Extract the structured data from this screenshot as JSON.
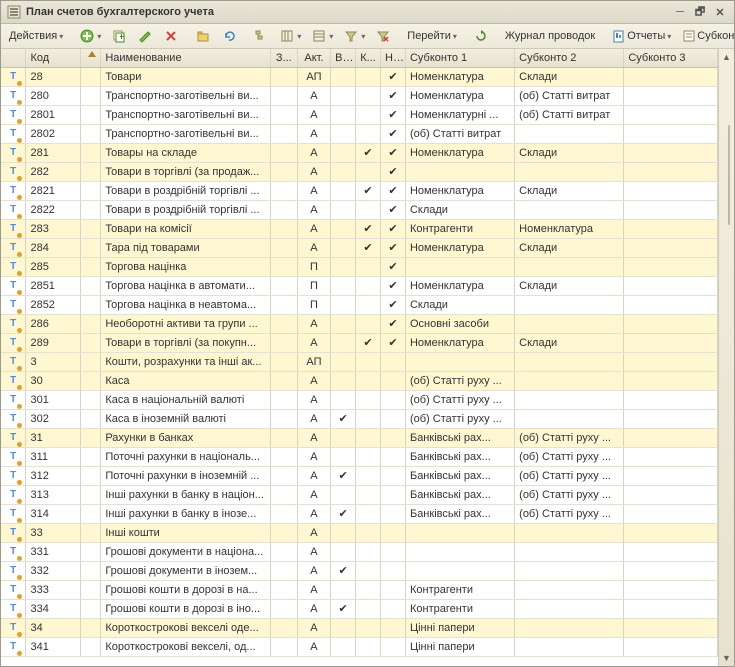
{
  "window": {
    "title": "План счетов бухгалтерского учета"
  },
  "toolbar": {
    "actions": "Действия",
    "go": "Перейти",
    "journal": "Журнал проводок",
    "reports": "Отчеты",
    "subkonto": "Субконто"
  },
  "columns": {
    "icon": "",
    "kod": "Код",
    "sort": "",
    "name": "Наименование",
    "z": "З...",
    "akt": "Акт.",
    "v": "В...",
    "k": "К...",
    "n": "Н...",
    "s1": "Субконто 1",
    "s2": "Субконто 2",
    "s3": "Субконто 3"
  },
  "rows": [
    {
      "kod": "28",
      "name": "Товари",
      "akt": "АП",
      "v": "",
      "k": "",
      "n": "✔",
      "s1": "Номенклатура",
      "s2": "Склади",
      "s3": "",
      "hl": true
    },
    {
      "kod": "280",
      "name": "Транспортно-заготівельні ви...",
      "akt": "А",
      "v": "",
      "k": "",
      "n": "✔",
      "s1": "Номенклатура",
      "s2": "(об) Статті витрат",
      "s3": ""
    },
    {
      "kod": "2801",
      "name": "Транспортно-заготівельні ви...",
      "akt": "А",
      "v": "",
      "k": "",
      "n": "✔",
      "s1": "Номенклатурні ...",
      "s2": "(об) Статті витрат",
      "s3": ""
    },
    {
      "kod": "2802",
      "name": "Транспортно-заготівельні ви...",
      "akt": "А",
      "v": "",
      "k": "",
      "n": "✔",
      "s1": "(об) Статті витрат",
      "s2": "",
      "s3": ""
    },
    {
      "kod": "281",
      "name": "Товары на складе",
      "akt": "А",
      "v": "",
      "k": "✔",
      "n": "✔",
      "s1": "Номенклатура",
      "s2": "Склади",
      "s3": "",
      "hl": true
    },
    {
      "kod": "282",
      "name": "Товари в торгівлі (за продаж...",
      "akt": "А",
      "v": "",
      "k": "",
      "n": "✔",
      "s1": "",
      "s2": "",
      "s3": "",
      "hl": true
    },
    {
      "kod": "2821",
      "name": "Товари в роздрібній торгівлі ...",
      "akt": "А",
      "v": "",
      "k": "✔",
      "n": "✔",
      "s1": "Номенклатура",
      "s2": "Склади",
      "s3": ""
    },
    {
      "kod": "2822",
      "name": "Товари в роздрібній торгівлі ...",
      "akt": "А",
      "v": "",
      "k": "",
      "n": "✔",
      "s1": "Склади",
      "s2": "",
      "s3": ""
    },
    {
      "kod": "283",
      "name": "Товари на комісії",
      "akt": "А",
      "v": "",
      "k": "✔",
      "n": "✔",
      "s1": "Контрагенти",
      "s2": "Номенклатура",
      "s3": "",
      "hl": true
    },
    {
      "kod": "284",
      "name": "Тара під товарами",
      "akt": "А",
      "v": "",
      "k": "✔",
      "n": "✔",
      "s1": "Номенклатура",
      "s2": "Склади",
      "s3": "",
      "hl": true
    },
    {
      "kod": "285",
      "name": "Торгова націнка",
      "akt": "П",
      "v": "",
      "k": "",
      "n": "✔",
      "s1": "",
      "s2": "",
      "s3": "",
      "hl": true
    },
    {
      "kod": "2851",
      "name": "Торгова націнка в автомати...",
      "akt": "П",
      "v": "",
      "k": "",
      "n": "✔",
      "s1": "Номенклатура",
      "s2": "Склади",
      "s3": ""
    },
    {
      "kod": "2852",
      "name": "Торгова націнка в неавтома...",
      "akt": "П",
      "v": "",
      "k": "",
      "n": "✔",
      "s1": "Склади",
      "s2": "",
      "s3": ""
    },
    {
      "kod": "286",
      "name": "Необоротні активи та групи ...",
      "akt": "А",
      "v": "",
      "k": "",
      "n": "✔",
      "s1": "Основні засоби",
      "s2": "",
      "s3": "",
      "hl": true
    },
    {
      "kod": "289",
      "name": "Товари в торгівлі (за покупн...",
      "akt": "А",
      "v": "",
      "k": "✔",
      "n": "✔",
      "s1": "Номенклатура",
      "s2": "Склади",
      "s3": "",
      "hl": true
    },
    {
      "kod": "3",
      "name": "Кошти, розрахунки та інші ак...",
      "akt": "АП",
      "v": "",
      "k": "",
      "n": "",
      "s1": "",
      "s2": "",
      "s3": "",
      "hl": true
    },
    {
      "kod": "30",
      "name": "Каса",
      "akt": "А",
      "v": "",
      "k": "",
      "n": "",
      "s1": "(об) Статті руху ...",
      "s2": "",
      "s3": "",
      "hl": true
    },
    {
      "kod": "301",
      "name": "Каса в національній валюті",
      "akt": "А",
      "v": "",
      "k": "",
      "n": "",
      "s1": "(об) Статті руху ...",
      "s2": "",
      "s3": ""
    },
    {
      "kod": "302",
      "name": "Каса в іноземній валюті",
      "akt": "А",
      "v": "✔",
      "k": "",
      "n": "",
      "s1": "(об) Статті руху ...",
      "s2": "",
      "s3": ""
    },
    {
      "kod": "31",
      "name": "Рахунки в банках",
      "akt": "А",
      "v": "",
      "k": "",
      "n": "",
      "s1": "Банківські рах...",
      "s2": "(об) Статті руху ...",
      "s3": "",
      "hl": true
    },
    {
      "kod": "311",
      "name": "Поточні рахунки в національ...",
      "akt": "А",
      "v": "",
      "k": "",
      "n": "",
      "s1": "Банківські рах...",
      "s2": "(об) Статті руху ...",
      "s3": ""
    },
    {
      "kod": "312",
      "name": "Поточні рахунки в іноземній ...",
      "akt": "А",
      "v": "✔",
      "k": "",
      "n": "",
      "s1": "Банківські рах...",
      "s2": "(об) Статті руху ...",
      "s3": ""
    },
    {
      "kod": "313",
      "name": "Інші рахунки в банку в націон...",
      "akt": "А",
      "v": "",
      "k": "",
      "n": "",
      "s1": "Банківські рах...",
      "s2": "(об) Статті руху ...",
      "s3": ""
    },
    {
      "kod": "314",
      "name": "Інші рахунки в банку в інозе...",
      "akt": "А",
      "v": "✔",
      "k": "",
      "n": "",
      "s1": "Банківські рах...",
      "s2": "(об) Статті руху ...",
      "s3": ""
    },
    {
      "kod": "33",
      "name": "Інші кошти",
      "akt": "А",
      "v": "",
      "k": "",
      "n": "",
      "s1": "",
      "s2": "",
      "s3": "",
      "hl": true
    },
    {
      "kod": "331",
      "name": "Грошові документи в націона...",
      "akt": "А",
      "v": "",
      "k": "",
      "n": "",
      "s1": "",
      "s2": "",
      "s3": ""
    },
    {
      "kod": "332",
      "name": "Грошові документи в інозем...",
      "akt": "А",
      "v": "✔",
      "k": "",
      "n": "",
      "s1": "",
      "s2": "",
      "s3": ""
    },
    {
      "kod": "333",
      "name": "Грошові кошти в дорозі в на...",
      "akt": "А",
      "v": "",
      "k": "",
      "n": "",
      "s1": "Контрагенти",
      "s2": "",
      "s3": ""
    },
    {
      "kod": "334",
      "name": "Грошові кошти в дорозі в іно...",
      "akt": "А",
      "v": "✔",
      "k": "",
      "n": "",
      "s1": "Контрагенти",
      "s2": "",
      "s3": ""
    },
    {
      "kod": "34",
      "name": "Короткострокові векселі оде...",
      "akt": "А",
      "v": "",
      "k": "",
      "n": "",
      "s1": "Цінні папери",
      "s2": "",
      "s3": "",
      "hl": true
    },
    {
      "kod": "341",
      "name": "Короткострокові векселі, од...",
      "akt": "А",
      "v": "",
      "k": "",
      "n": "",
      "s1": "Цінні папери",
      "s2": "",
      "s3": ""
    }
  ]
}
